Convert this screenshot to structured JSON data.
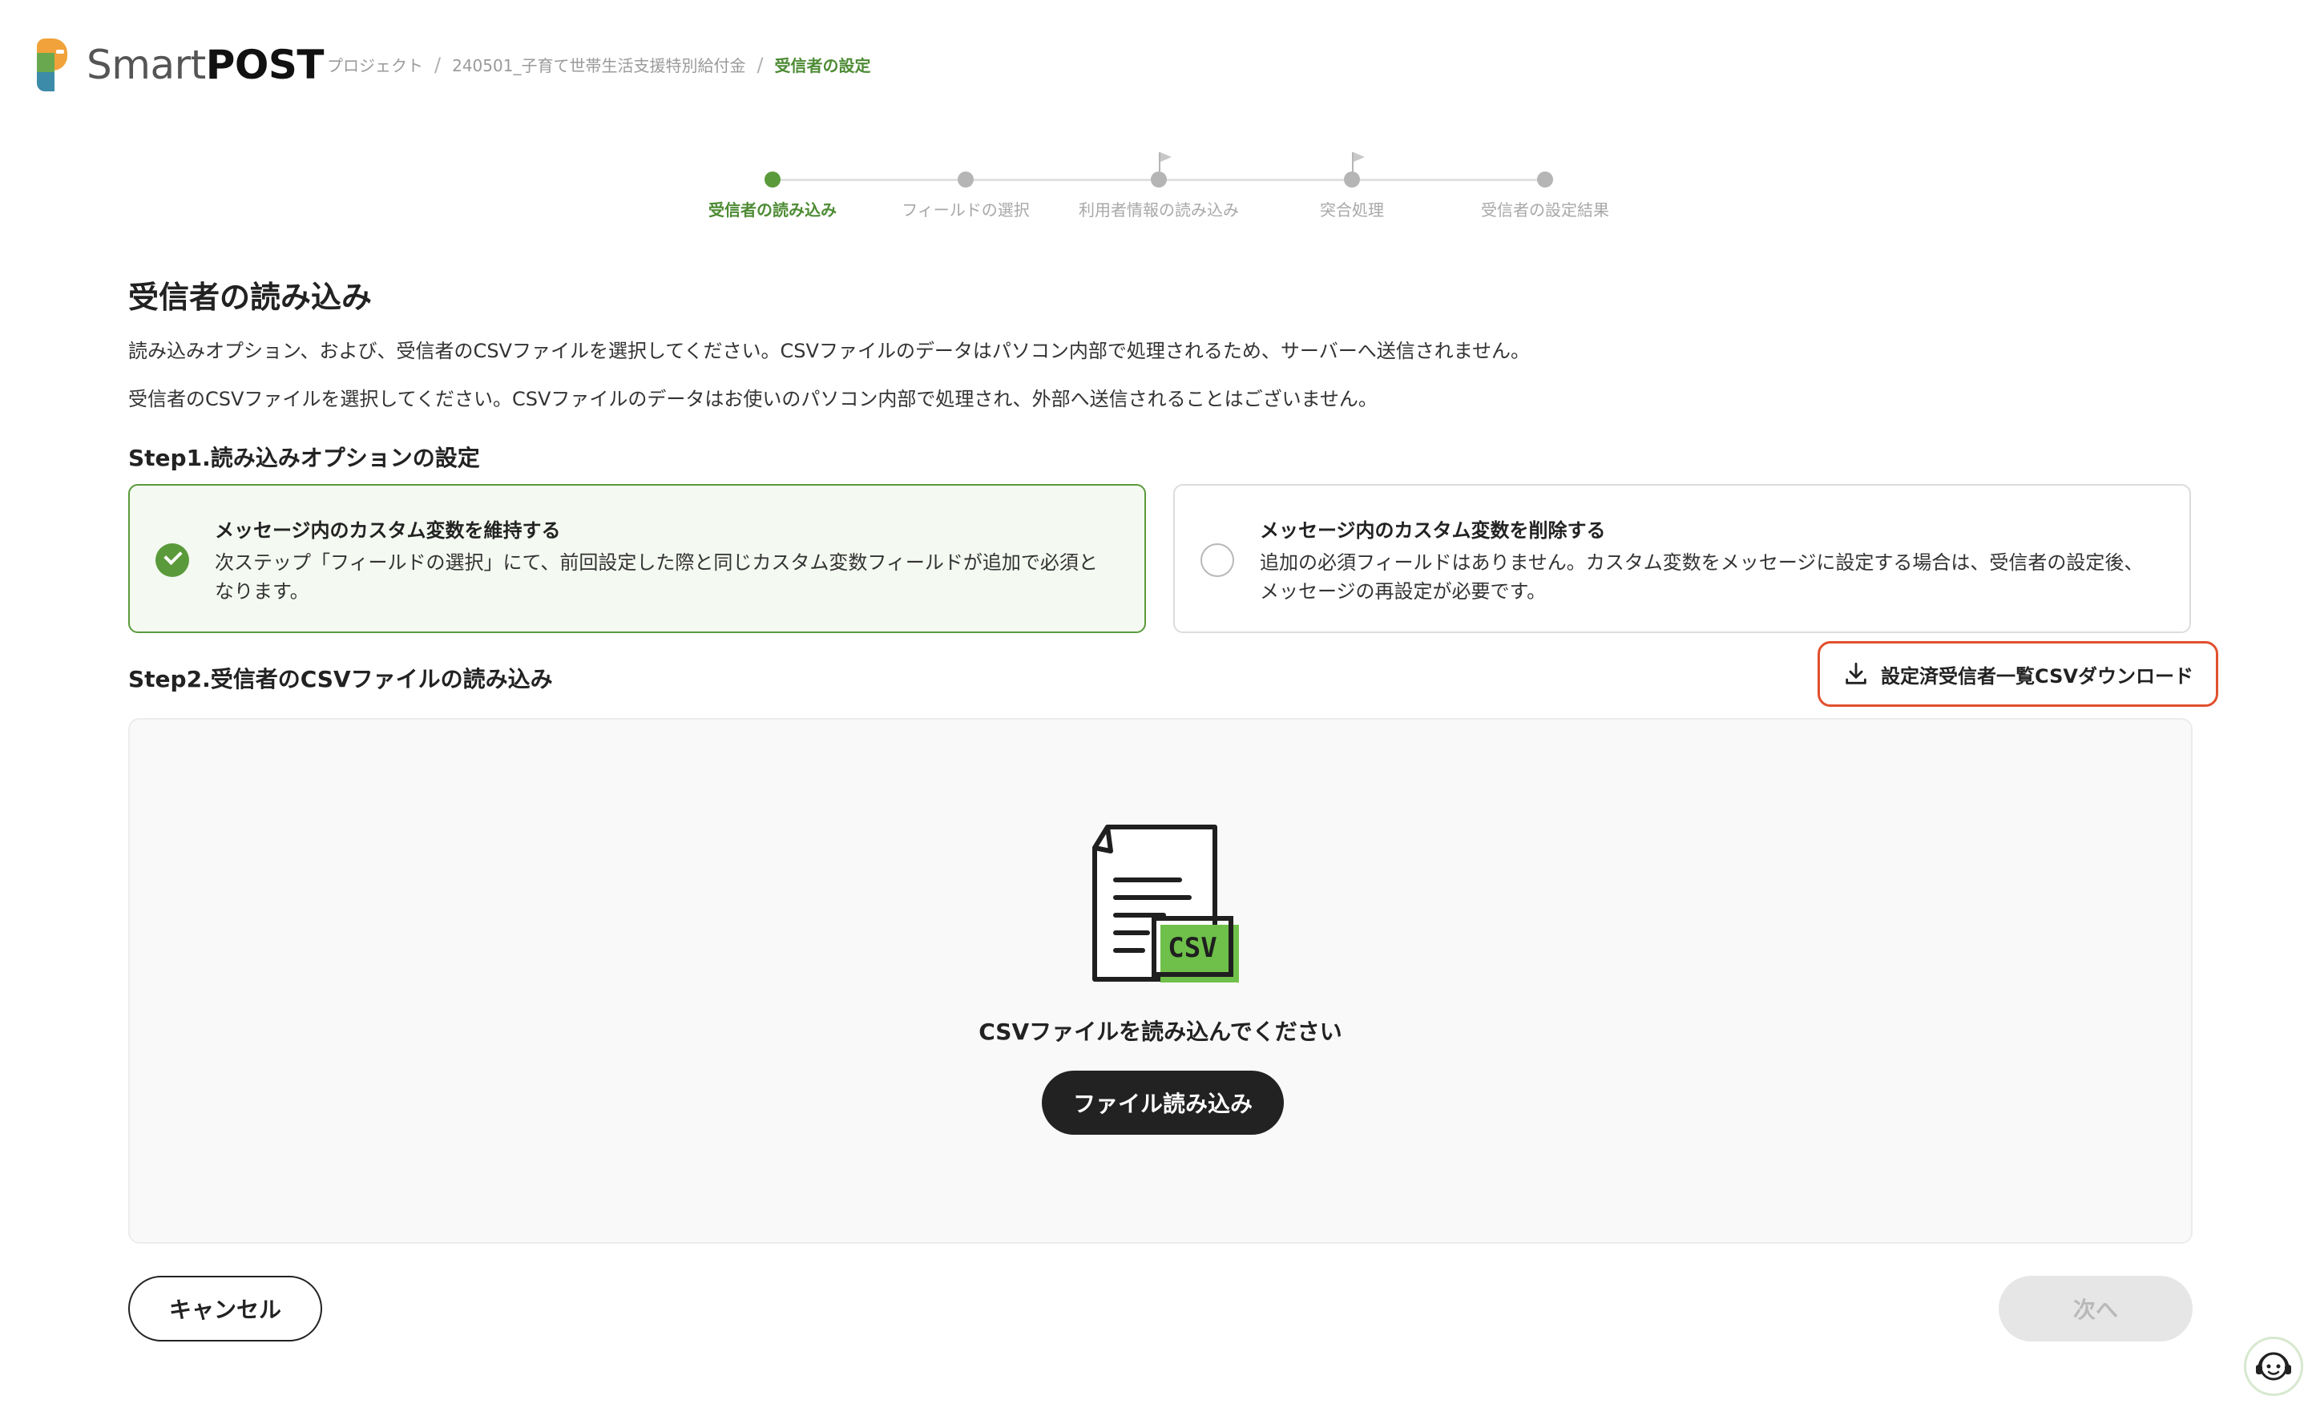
{
  "header": {
    "logo_light": "Smart",
    "logo_bold": "POST",
    "breadcrumb": [
      "プロジェクト",
      "240501_子育て世帯生活支援特別給付金",
      "受信者の設定"
    ]
  },
  "stepper": {
    "steps": [
      {
        "label": "受信者の読み込み",
        "state": "active"
      },
      {
        "label": "フィールドの選択",
        "state": "inactive"
      },
      {
        "label": "利用者情報の読み込み",
        "state": "inactive"
      },
      {
        "label": "突合処理",
        "state": "inactive"
      },
      {
        "label": "受信者の設定結果",
        "state": "inactive"
      }
    ]
  },
  "main": {
    "title": "受信者の読み込み",
    "description_1": "読み込みオプション、および、受信者のCSVファイルを選択してください。CSVファイルのデータはパソコン内部で処理されるため、サーバーへ送信されません。",
    "description_2": "受信者のCSVファイルを選択してください。CSVファイルのデータはお使いのパソコン内部で処理され、外部へ送信されることはございません。",
    "step1_title": "Step1.読み込みオプションの設定",
    "options": [
      {
        "title": "メッセージ内のカスタム変数を維持する",
        "description": "次ステップ「フィールドの選択」にて、前回設定した際と同じカスタム変数フィールドが追加で必須となります。",
        "selected": true
      },
      {
        "title": "メッセージ内のカスタム変数を削除する",
        "description": "追加の必須フィールドはありません。カスタム変数をメッセージに設定する場合は、受信者の設定後、メッセージの再設定が必要です。",
        "selected": false
      }
    ],
    "step2_title": "Step2.受信者のCSVファイルの読み込み",
    "download_label": "設定済受信者一覧CSVダウンロード",
    "dropzone": {
      "badge": "CSV",
      "prompt": "CSVファイルを読み込んでください",
      "button_label": "ファイル読み込み"
    }
  },
  "footer": {
    "cancel_label": "キャンセル",
    "next_label": "次へ"
  },
  "colors": {
    "accent_green": "#5a9a3a",
    "highlight_red": "#e1502e",
    "dark_button": "#222222"
  }
}
